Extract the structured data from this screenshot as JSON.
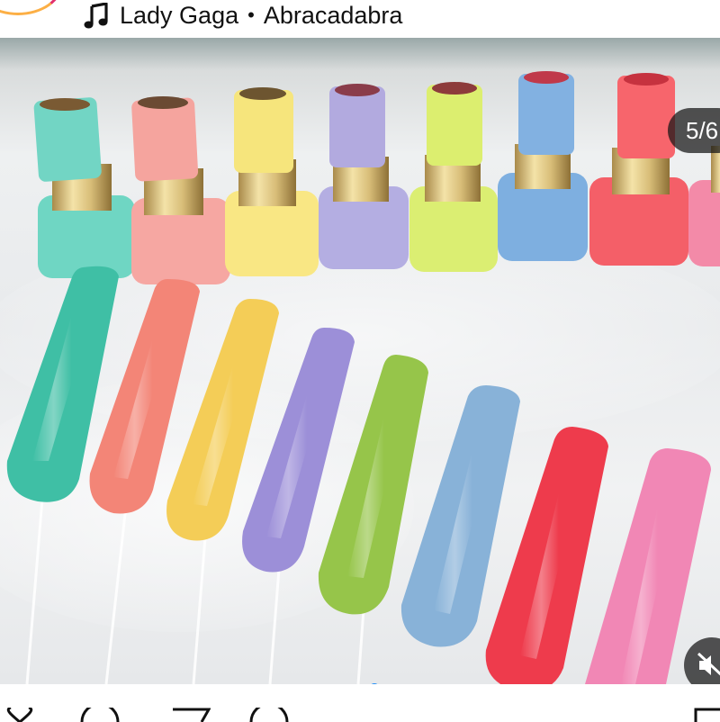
{
  "audio": {
    "artist": "Lady Gaga",
    "separator": "•",
    "track": "Abracadabra"
  },
  "carousel": {
    "counter": "5/6",
    "total_dots": 6,
    "active_dot": 4
  },
  "icons": {
    "music": "music-note-icon",
    "mute": "speaker-muted-icon",
    "like": "heart-icon",
    "comment": "comment-icon",
    "share": "send-icon",
    "save": "bookmark-icon"
  },
  "colors": {
    "active_dot": "#1d8cf8",
    "story_ring": "#e1306c"
  }
}
